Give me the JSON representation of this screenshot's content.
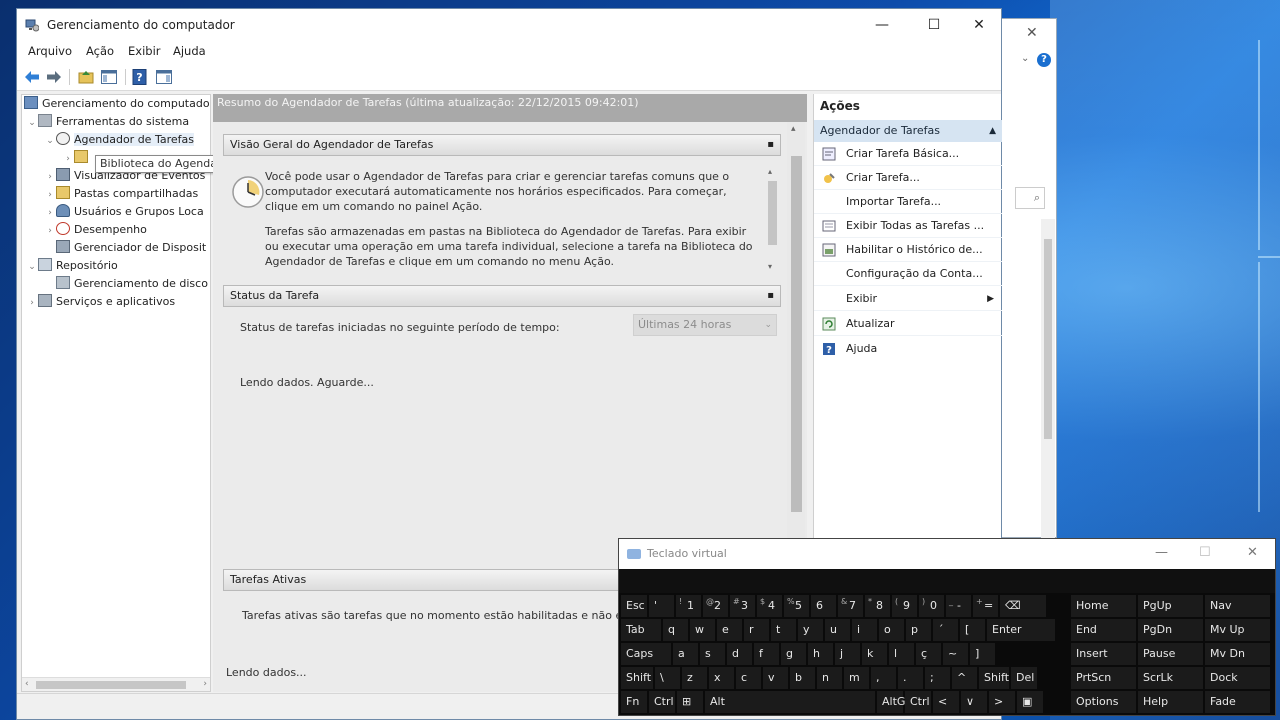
{
  "window": {
    "title": "Gerenciamento do computador",
    "minimize_label": "—",
    "maximize_label": "☐",
    "close_label": "✕"
  },
  "menu": [
    "Arquivo",
    "Ação",
    "Exibir",
    "Ajuda"
  ],
  "tree": {
    "root": "Gerenciamento do computador",
    "system_tools": "Ferramentas do sistema",
    "task_scheduler": "Agendador de Tarefas",
    "task_library": "Biblioteca do Agendador de Tarefas",
    "event_viewer": "Visualizador de Eventos",
    "shared_folders": "Pastas compartilhadas",
    "users_groups": "Usuários e Grupos Loca",
    "performance": "Desempenho",
    "device_manager": "Gerenciador de Disposit",
    "storage": "Repositório",
    "disk_management": "Gerenciamento de disco",
    "services_apps": "Serviços e aplicativos",
    "tooltip": "Biblioteca do Agendador de Tarefas"
  },
  "center": {
    "header": "Resumo do Agendador de Tarefas (última atualização: 22/12/2015 09:42:01)",
    "overview_title": "Visão Geral do Agendador de Tarefas",
    "overview_p1": "Você pode usar o Agendador de Tarefas para criar e gerenciar tarefas comuns que o computador executará automaticamente nos horários especificados. Para começar, clique em um comando no painel Ação.",
    "overview_p2": "Tarefas são armazenadas em pastas na Biblioteca do Agendador de Tarefas. Para exibir ou executar uma operação em uma tarefa individual, selecione a tarefa na Biblioteca do Agendador de Tarefas e clique em um comando no menu Ação.",
    "status_title": "Status da Tarefa",
    "status_label": "Status de tarefas iniciadas no seguinte período de tempo:",
    "status_select": "Últimas 24 horas",
    "loading1": "Lendo dados. Aguarde...",
    "active_title": "Tarefas Ativas",
    "active_desc": "Tarefas ativas são tarefas que no momento estão habilitadas e não e",
    "loading2": "Lendo dados..."
  },
  "actions": {
    "title": "Ações",
    "group": "Agendador de Tarefas",
    "items": [
      "Criar Tarefa Básica...",
      "Criar Tarefa...",
      "Importar Tarefa...",
      "Exibir Todas as Tarefas ...",
      "Habilitar o Histórico de...",
      "Configuração da Conta...",
      "Exibir",
      "Atualizar",
      "Ajuda"
    ]
  },
  "keyboard": {
    "title": "Teclado virtual",
    "row1": [
      "Esc",
      "'",
      "1",
      "2",
      "3",
      "4",
      "5",
      "6",
      "7",
      "8",
      "9",
      "0",
      "-",
      "=",
      "⌫"
    ],
    "row1_sup": [
      "",
      "",
      "!",
      "@",
      "#",
      "$",
      "%",
      "",
      "&",
      "*",
      "(",
      ")",
      "_",
      "+",
      ""
    ],
    "row2": [
      "Tab",
      "q",
      "w",
      "e",
      "r",
      "t",
      "y",
      "u",
      "i",
      "o",
      "p",
      "´",
      "[",
      "Enter"
    ],
    "row3": [
      "Caps",
      "a",
      "s",
      "d",
      "f",
      "g",
      "h",
      "j",
      "k",
      "l",
      "ç",
      "~",
      "]"
    ],
    "row4": [
      "Shift",
      "\\",
      "z",
      "x",
      "c",
      "v",
      "b",
      "n",
      "m",
      ",",
      ".",
      ";",
      "^",
      "Shift",
      "Del"
    ],
    "row5": [
      "Fn",
      "Ctrl",
      "⊞",
      "Alt",
      "AltG",
      "Ctrl",
      "<",
      "∨",
      ">",
      "▣"
    ],
    "nav": [
      [
        "Home",
        "PgUp",
        "Nav"
      ],
      [
        "End",
        "PgDn",
        "Mv Up"
      ],
      [
        "Insert",
        "Pause",
        "Mv Dn"
      ],
      [
        "PrtScn",
        "ScrLk",
        "Dock"
      ],
      [
        "Options",
        "Help",
        "Fade"
      ]
    ]
  }
}
